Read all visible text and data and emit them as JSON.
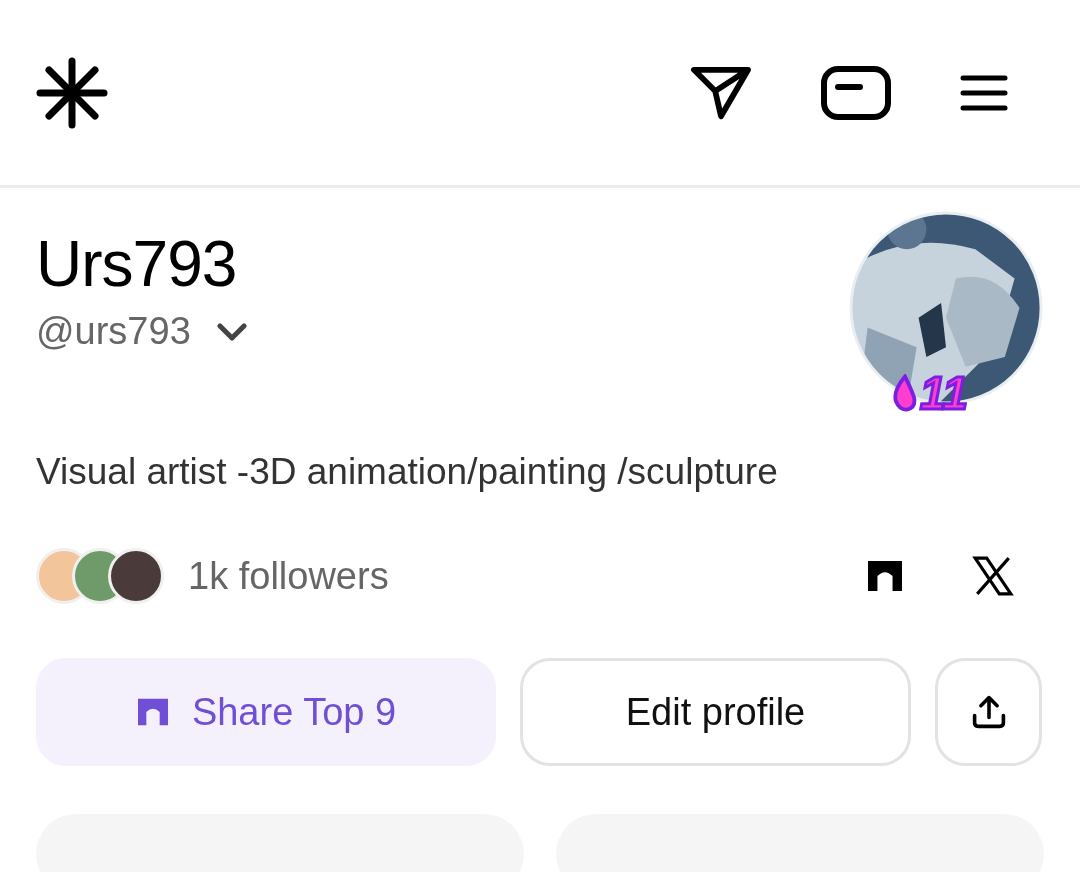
{
  "profile": {
    "name": "Urs793",
    "handle": "@urs793",
    "badge": "11",
    "bio": "Visual artist -3D animation/painting /sculpture"
  },
  "followers": {
    "count": "1k followers",
    "avatars": [
      {
        "color": "#f2c59a"
      },
      {
        "color": "#6f9a6a"
      },
      {
        "color": "#4a3a3a"
      }
    ]
  },
  "buttons": [
    {
      "kind": "share",
      "label": "Share Top 9"
    },
    {
      "kind": "edit",
      "label": "Edit profile"
    },
    {
      "kind": "upload"
    }
  ]
}
